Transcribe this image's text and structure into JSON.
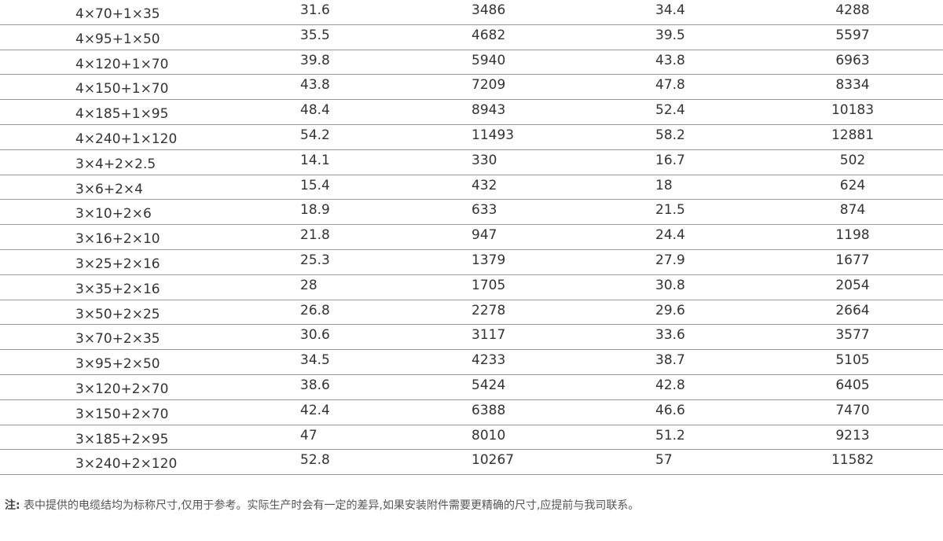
{
  "table": {
    "rows": [
      [
        "4×70+1×35",
        "31.6",
        "3486",
        "34.4",
        "4288"
      ],
      [
        "4×95+1×50",
        "35.5",
        "4682",
        "39.5",
        "5597"
      ],
      [
        "4×120+1×70",
        "39.8",
        "5940",
        "43.8",
        "6963"
      ],
      [
        "4×150+1×70",
        "43.8",
        "7209",
        "47.8",
        "8334"
      ],
      [
        "4×185+1×95",
        "48.4",
        "8943",
        "52.4",
        "10183"
      ],
      [
        "4×240+1×120",
        "54.2",
        "11493",
        "58.2",
        "12881"
      ],
      [
        "3×4+2×2.5",
        "14.1",
        "330",
        "16.7",
        "502"
      ],
      [
        "3×6+2×4",
        "15.4",
        "432",
        "18",
        "624"
      ],
      [
        "3×10+2×6",
        "18.9",
        "633",
        "21.5",
        "874"
      ],
      [
        "3×16+2×10",
        "21.8",
        "947",
        "24.4",
        "1198"
      ],
      [
        "3×25+2×16",
        "25.3",
        "1379",
        "27.9",
        "1677"
      ],
      [
        "3×35+2×16",
        "28",
        "1705",
        "30.8",
        "2054"
      ],
      [
        "3×50+2×25",
        "26.8",
        "2278",
        "29.6",
        "2664"
      ],
      [
        "3×70+2×35",
        "30.6",
        "3117",
        "33.6",
        "3577"
      ],
      [
        "3×95+2×50",
        "34.5",
        "4233",
        "38.7",
        "5105"
      ],
      [
        "3×120+2×70",
        "38.6",
        "5424",
        "42.8",
        "6405"
      ],
      [
        "3×150+2×70",
        "42.4",
        "6388",
        "46.6",
        "7470"
      ],
      [
        "3×185+2×95",
        "47",
        "8010",
        "51.2",
        "9213"
      ],
      [
        "3×240+2×120",
        "52.8",
        "10267",
        "57",
        "11582"
      ]
    ]
  },
  "note": {
    "label": "注:",
    "text": "表中提供的电缆结均为标称尺寸,仅用于参考。实际生产时会有一定的差异,如果安装附件需要更精确的尺寸,应提前与我司联系。"
  }
}
